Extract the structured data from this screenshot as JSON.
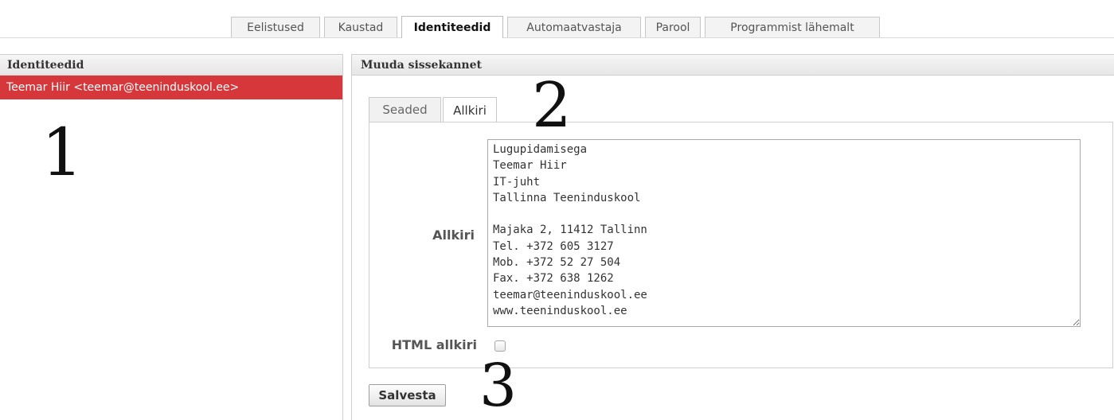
{
  "top_tabs": [
    {
      "label": "Eelistused",
      "active": false
    },
    {
      "label": "Kaustad",
      "active": false
    },
    {
      "label": "Identiteedid",
      "active": true
    },
    {
      "label": "Automaatvastaja",
      "active": false
    },
    {
      "label": "Parool",
      "active": false
    },
    {
      "label": "Programmist lähemalt",
      "active": false
    }
  ],
  "left_panel": {
    "header": "Identiteedid",
    "identities": [
      "Teemar Hiir <teemar@teeninduskool.ee>"
    ]
  },
  "right_panel": {
    "header": "Muuda sissekannet",
    "tabs": [
      {
        "label": "Seaded",
        "active": false
      },
      {
        "label": "Allkiri",
        "active": true
      }
    ],
    "signature_label": "Allkiri",
    "signature_text": "Lugupidamisega\nTeemar Hiir\nIT-juht\nTallinna Teeninduskool\n\nMajaka 2, 11412 Tallinn\nTel. +372 605 3127\nMob. +372 52 27 504\nFax. +372 638 1262\nteemar@teeninduskool.ee\nwww.teeninduskool.ee",
    "html_signature_label": "HTML allkiri",
    "html_signature_checked": false,
    "save_label": "Salvesta"
  },
  "annotations": [
    "1",
    "2",
    "3"
  ],
  "colors": {
    "selected_row": "#d6373a"
  }
}
